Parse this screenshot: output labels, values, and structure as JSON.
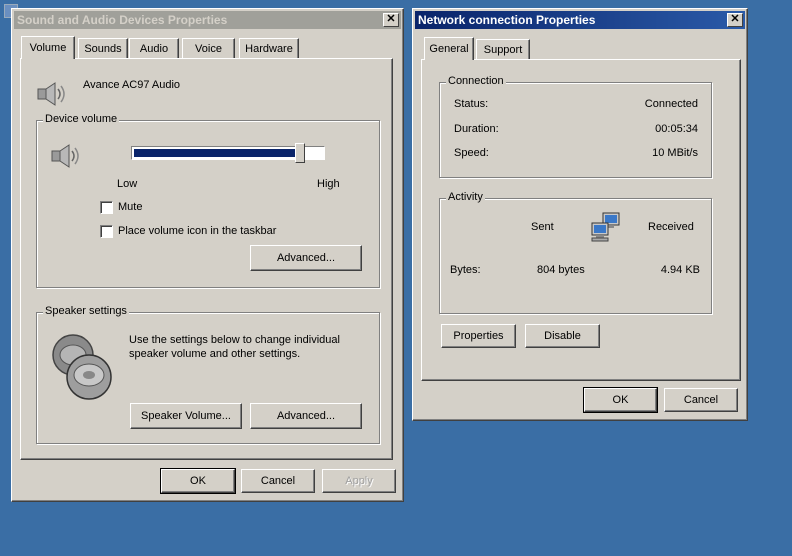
{
  "sound_window": {
    "title": "Sound and Audio Devices Properties",
    "tabs": [
      "Volume",
      "Sounds",
      "Audio",
      "Voice",
      "Hardware"
    ],
    "selected_tab": "Volume",
    "device_name": "Avance AC97 Audio",
    "device_volume": {
      "group_title": "Device volume",
      "slider_level": 0.88,
      "low_label": "Low",
      "high_label": "High",
      "mute_label": "Mute",
      "mute_checked": false,
      "taskbar_label": "Place volume icon in the taskbar",
      "taskbar_checked": false,
      "advanced_label": "Advanced..."
    },
    "speaker_settings": {
      "group_title": "Speaker settings",
      "description": "Use the settings below to change individual speaker volume and other settings.",
      "speaker_volume_label": "Speaker Volume...",
      "advanced_label": "Advanced..."
    },
    "buttons": {
      "ok": "OK",
      "cancel": "Cancel",
      "apply": "Apply"
    }
  },
  "network_window": {
    "title": "Network connection Properties",
    "tabs": [
      "General",
      "Support"
    ],
    "selected_tab": "General",
    "connection": {
      "group_title": "Connection",
      "status_label": "Status:",
      "status_value": "Connected",
      "duration_label": "Duration:",
      "duration_value": "00:05:34",
      "speed_label": "Speed:",
      "speed_value": "10 MBit/s"
    },
    "activity": {
      "group_title": "Activity",
      "sent_label": "Sent",
      "received_label": "Received",
      "bytes_label": "Bytes:",
      "bytes_sent": "804 bytes",
      "bytes_received": "4.94 KB"
    },
    "properties_label": "Properties",
    "disable_label": "Disable",
    "buttons": {
      "ok": "OK",
      "cancel": "Cancel"
    }
  },
  "icons": {
    "speaker": "speaker-icon",
    "speakers_pair": "speakers-icon",
    "network": "network-computers-icon",
    "close": "close-icon"
  },
  "colors": {
    "desktop": "#3a6ea5",
    "active_title": "#0a246a",
    "inactive_title": "#a0a09a",
    "window_face": "#d4d0c8"
  }
}
